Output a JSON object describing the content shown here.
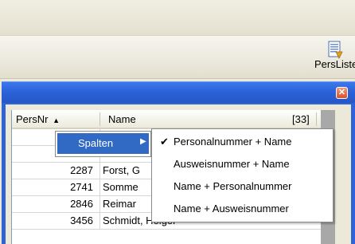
{
  "toolbar": {
    "persliste_label": "PersListe"
  },
  "window": {
    "close_glyph": "✕"
  },
  "grid": {
    "header": {
      "col_nr": "PersNr",
      "sort_glyph": "▲",
      "col_name": "Name",
      "count": "[33]"
    },
    "rows": [
      {
        "nr": "",
        "name": ""
      },
      {
        "nr": "",
        "name": ""
      },
      {
        "nr": "2287",
        "name": "Forst, G"
      },
      {
        "nr": "2741",
        "name": "Somme"
      },
      {
        "nr": "2846",
        "name": "Reimar"
      },
      {
        "nr": "3456",
        "name": "Schmidt, Holger"
      }
    ]
  },
  "context_menu": {
    "label": "Spalten",
    "arrow": "▶",
    "submenu": [
      {
        "label": "Personalnummer + Name",
        "checked": "✔"
      },
      {
        "label": "Ausweisnummer + Name",
        "checked": ""
      },
      {
        "label": "Name + Personalnummer",
        "checked": ""
      },
      {
        "label": "Name + Ausweisnummer",
        "checked": ""
      }
    ]
  },
  "colors": {
    "title_blue": "#2d62d8",
    "highlight": "#316ac5",
    "close_red": "#d9502b"
  }
}
